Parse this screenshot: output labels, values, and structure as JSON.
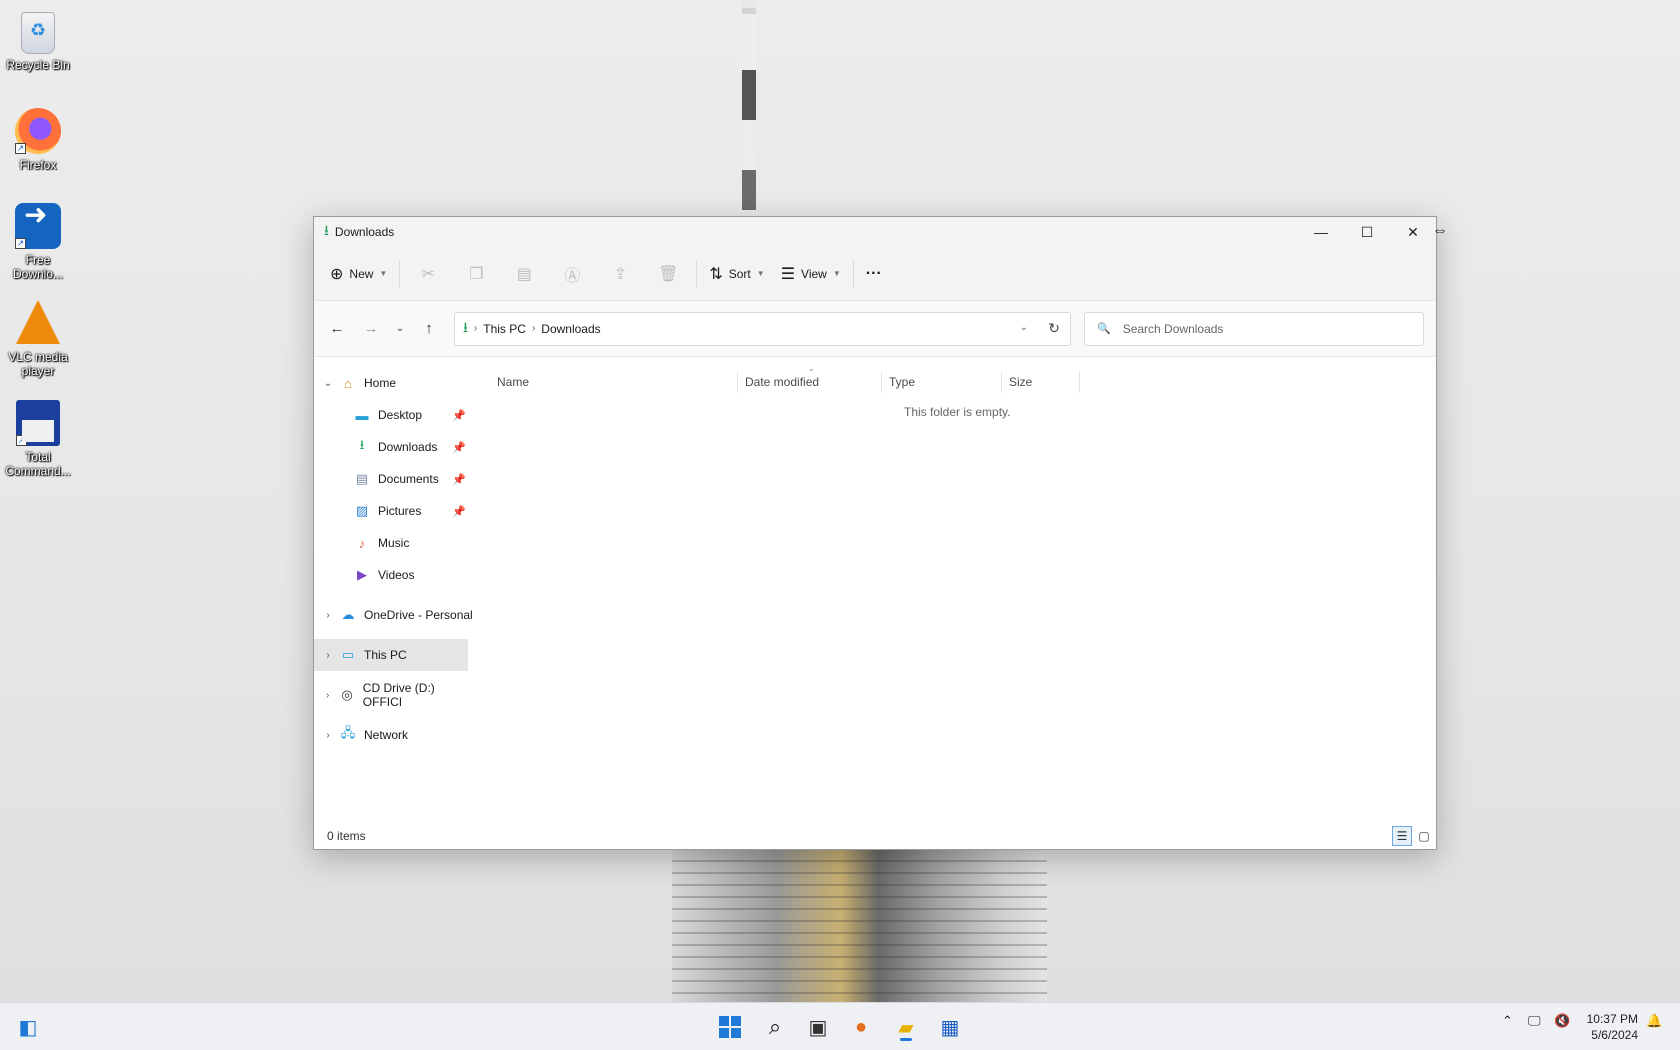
{
  "desktop": {
    "icons": [
      {
        "label": "Recycle Bin"
      },
      {
        "label": "Firefox"
      },
      {
        "label": "Free Downlo..."
      },
      {
        "label": "VLC media player"
      },
      {
        "label": "Total Command..."
      }
    ]
  },
  "window": {
    "title": "Downloads",
    "controls": {
      "minimize": "—",
      "maximize": "☐",
      "close": "✕"
    },
    "toolbar": {
      "new_label": "New",
      "sort_label": "Sort",
      "view_label": "View",
      "more_label": "···"
    },
    "address": {
      "crumbs": [
        "This PC",
        "Downloads"
      ]
    },
    "search": {
      "placeholder": "Search Downloads"
    },
    "nav": {
      "home": "Home",
      "quick": [
        {
          "label": "Desktop",
          "pinned": true
        },
        {
          "label": "Downloads",
          "pinned": true
        },
        {
          "label": "Documents",
          "pinned": true
        },
        {
          "label": "Pictures",
          "pinned": true
        },
        {
          "label": "Music",
          "pinned": false
        },
        {
          "label": "Videos",
          "pinned": false
        }
      ],
      "roots": [
        {
          "label": "OneDrive - Personal"
        },
        {
          "label": "This PC",
          "selected": true
        },
        {
          "label": "CD Drive (D:) OFFICI"
        },
        {
          "label": "Network"
        }
      ]
    },
    "columns": [
      "Name",
      "Date modified",
      "Type",
      "Size"
    ],
    "empty_message": "This folder is empty.",
    "status": {
      "items": "0 items"
    }
  },
  "taskbar": {
    "clock": {
      "time": "10:37 PM",
      "date": "5/6/2024"
    }
  }
}
